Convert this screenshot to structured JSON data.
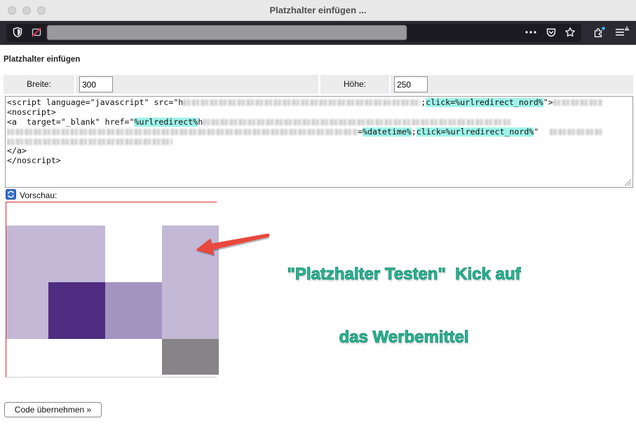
{
  "window": {
    "title": "Platzhalter einfügen ..."
  },
  "toolbar": {
    "icons": {
      "tracking_protection": "shield-icon",
      "site_permissions": "blocked-permission-icon",
      "page_actions": "more-actions-icon",
      "pocket": "pocket-icon",
      "bookmark": "star-icon",
      "extensions": "extensions-icon",
      "app_menu": "hamburger-menu-icon"
    }
  },
  "form": {
    "heading": "Platzhalter einfügen",
    "width_label": "Breite:",
    "width_value": "300",
    "height_label": "Höhe:",
    "height_value": "250",
    "preview_label": "Vorschau:",
    "submit_label": "Code übernehmen »"
  },
  "editor": {
    "lines": [
      [
        "<script language=\"javascript\" src=\"h",
        ";",
        "click=%urlredirect_nord%",
        "\">"
      ],
      [
        "<noscript>"
      ],
      [
        "<a  target=\"_blank\" href=\"",
        "%urlredirect%",
        "h"
      ],
      [
        "=",
        "%datetime%",
        ";",
        "click=%urlredirect_nord%",
        "\""
      ],
      [],
      [
        "</a>"
      ],
      [
        "</noscript>"
      ]
    ]
  },
  "preview": {
    "colors": {
      "light": "#c3b8d5",
      "medium": "#a494c0",
      "dark": "#4f2c80",
      "gray": "#868488"
    }
  },
  "annotation": {
    "line1": "\"Platzhalter Testen\"  Kick auf",
    "line2": "das Werbemittel"
  },
  "theme": {
    "titlebar_bg": "#e8e8e8",
    "toolbar_bg": "#2b2a33",
    "urlbar_bg": "#1c1b22",
    "code_highlight": "#9ff3ea",
    "preview_border": "#d9322a",
    "annotation_text": "#2ab894",
    "annotation_arrow": "#e8483d"
  }
}
